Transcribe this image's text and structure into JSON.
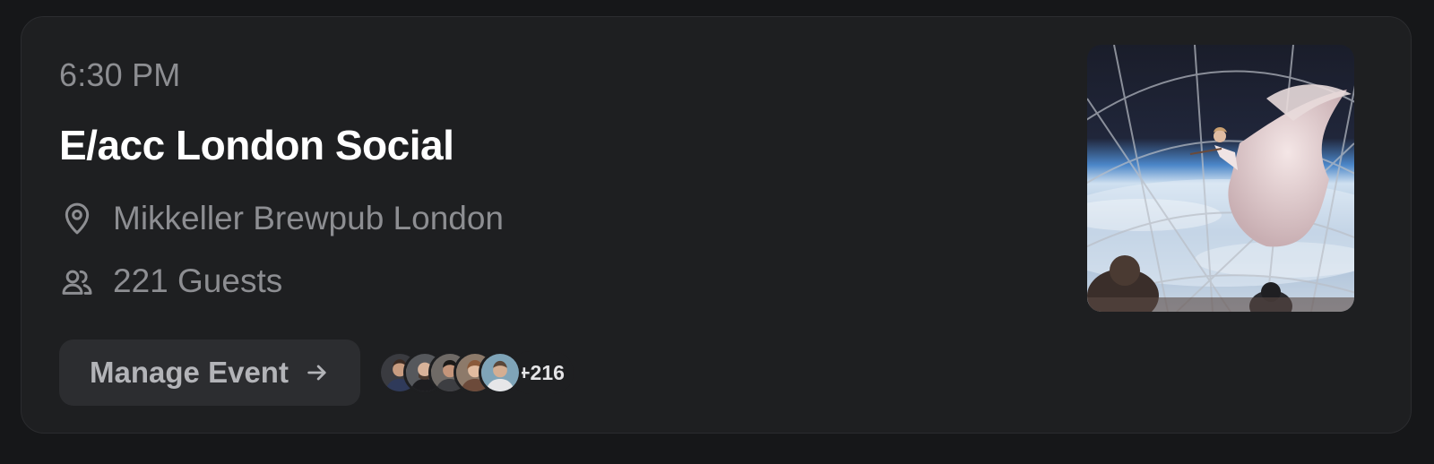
{
  "event": {
    "time": "6:30 PM",
    "title": "E/acc London Social",
    "location": "Mikkeller Brewpub London",
    "guests_label": "221 Guests"
  },
  "actions": {
    "manage_label": "Manage Event"
  },
  "attendees": {
    "more_count": "+216"
  },
  "icons": {
    "location": "map-pin-icon",
    "guests": "users-icon",
    "arrow": "arrow-right-icon"
  },
  "colors": {
    "background": "#161719",
    "card": "#1e1f21",
    "title": "#ffffff",
    "muted_text": "#8d8e92",
    "button_bg": "#2c2d30"
  }
}
